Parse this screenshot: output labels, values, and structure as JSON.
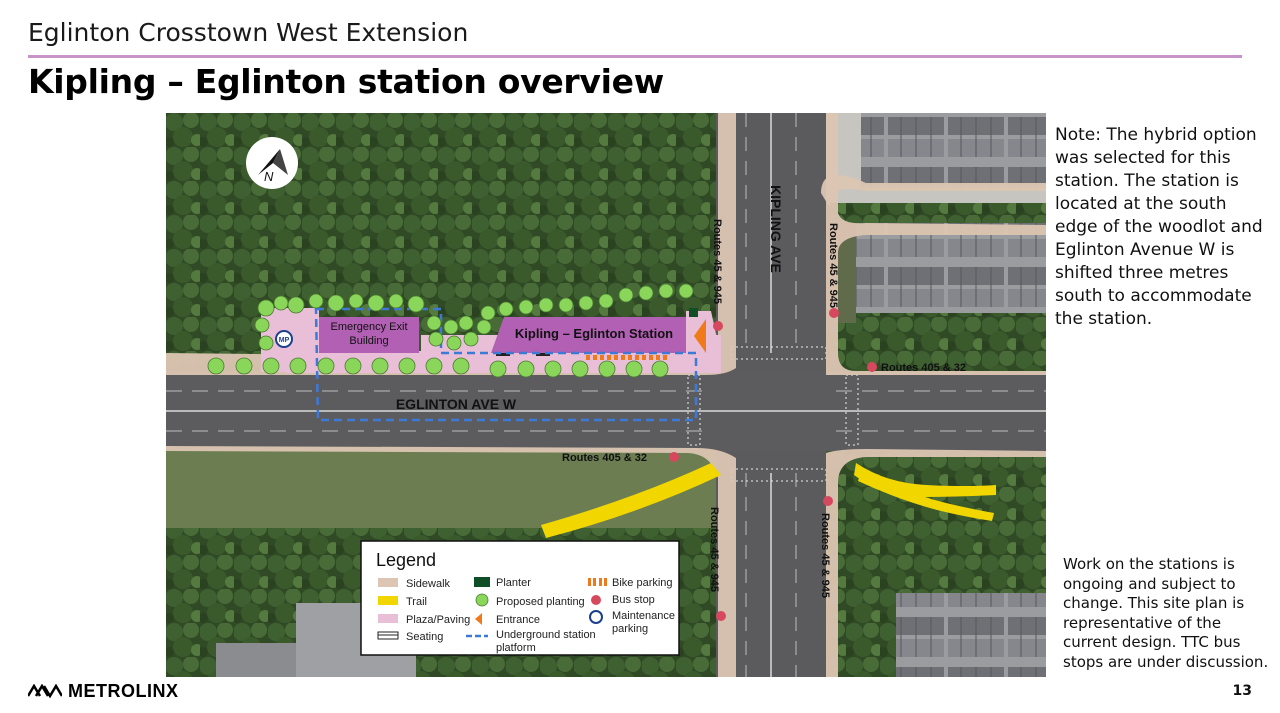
{
  "header": {
    "subtitle": "Eglinton Crosstown West Extension",
    "title": "Kipling – Eglinton station overview"
  },
  "map": {
    "north_label": "N",
    "station_label": "Kipling – Eglinton Station",
    "emergency_label_line1": "Emergency Exit",
    "emergency_label_line2": "Building",
    "maintenance_badge": "MP",
    "road_eglinton": "EGLINTON AVE W",
    "road_kipling": "KIPLING AVE",
    "bus_route_ns": "Routes 45 & 945",
    "bus_route_ew": "Routes 405 & 32"
  },
  "legend": {
    "title": "Legend",
    "items": {
      "sidewalk": "Sidewalk",
      "trail": "Trail",
      "plaza": "Plaza/Paving",
      "seating": "Seating",
      "planter": "Planter",
      "proposed_planting": "Proposed planting",
      "entrance": "Entrance",
      "platform_line1": "Underground station",
      "platform_line2": "platform",
      "bike_parking": "Bike parking",
      "bus_stop": "Bus stop",
      "maintenance_line1": "Maintenance",
      "maintenance_line2": "parking"
    }
  },
  "notes": {
    "note1": "Note: The hybrid option was selected for this station. The station is located at the south edge of the woodlot and Eglinton Avenue W is shifted three metres south to accommodate the station.",
    "note2": "Work on the stations is ongoing and subject to change. This site plan is representative of the current design. TTC bus stops are under discussion."
  },
  "footer": {
    "logo_text": "METROLINX",
    "page_number": "13"
  },
  "colors": {
    "accent_rule": "#c893c9",
    "plaza": "#e8bfd6",
    "station": "#b160b3",
    "trail": "#f2d600",
    "sidewalk": "#dcc5b2",
    "planting": "#8ad65a",
    "entrance": "#f07a1a",
    "platform": "#3d7ad8",
    "bus_stop": "#d6485e"
  },
  "icons": [
    "north-arrow-icon",
    "bus-stop-icon",
    "maintenance-parking-icon",
    "entrance-icon",
    "bike-parking-icon",
    "metrolinx-logo-icon"
  ]
}
